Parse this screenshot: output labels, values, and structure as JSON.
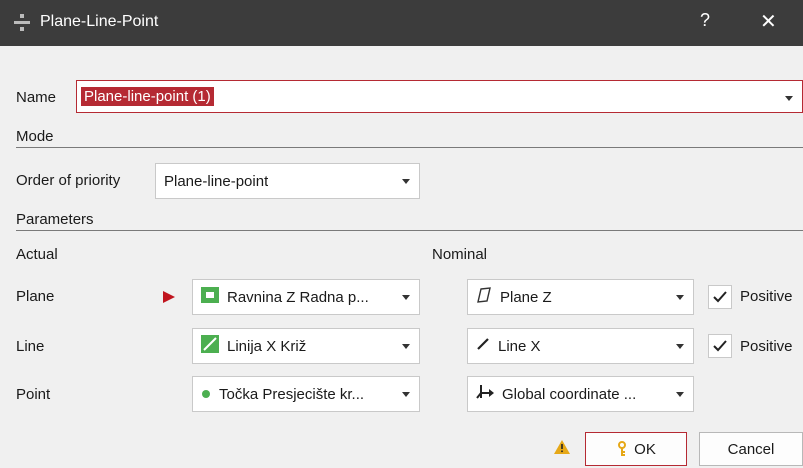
{
  "window": {
    "title": "Plane-Line-Point",
    "help_label": "?",
    "close_label": "✕"
  },
  "name": {
    "label": "Name",
    "value": "Plane-line-point (1)"
  },
  "mode": {
    "section_title": "Mode",
    "order_label": "Order of priority",
    "order_value": "Plane-line-point"
  },
  "parameters": {
    "section_title": "Parameters",
    "actual_header": "Actual",
    "nominal_header": "Nominal",
    "rows": [
      {
        "label": "Plane",
        "actual_value": "Ravnina Z Radna p...",
        "actual_icon": "plane-feature-icon",
        "nominal_value": "Plane Z",
        "nominal_icon": "plane-outline-icon",
        "positive_label": "Positive",
        "positive_checked": true
      },
      {
        "label": "Line",
        "actual_value": "Linija X Križ",
        "actual_icon": "line-feature-icon",
        "nominal_value": "Line X",
        "nominal_icon": "line-icon",
        "positive_label": "Positive",
        "positive_checked": true
      },
      {
        "label": "Point",
        "actual_value": "Točka Presjecište kr...",
        "actual_icon": "point-feature-icon",
        "nominal_value": "Global coordinate ...",
        "nominal_icon": "coordinate-system-icon"
      }
    ]
  },
  "buttons": {
    "ok": "OK",
    "cancel": "Cancel"
  },
  "colors": {
    "titlebar": "#3c3c3c",
    "accent": "#b52a33",
    "dialog_bg": "#f0f0f0",
    "feature_green": "#4caf50",
    "warning": "#e6a817"
  }
}
